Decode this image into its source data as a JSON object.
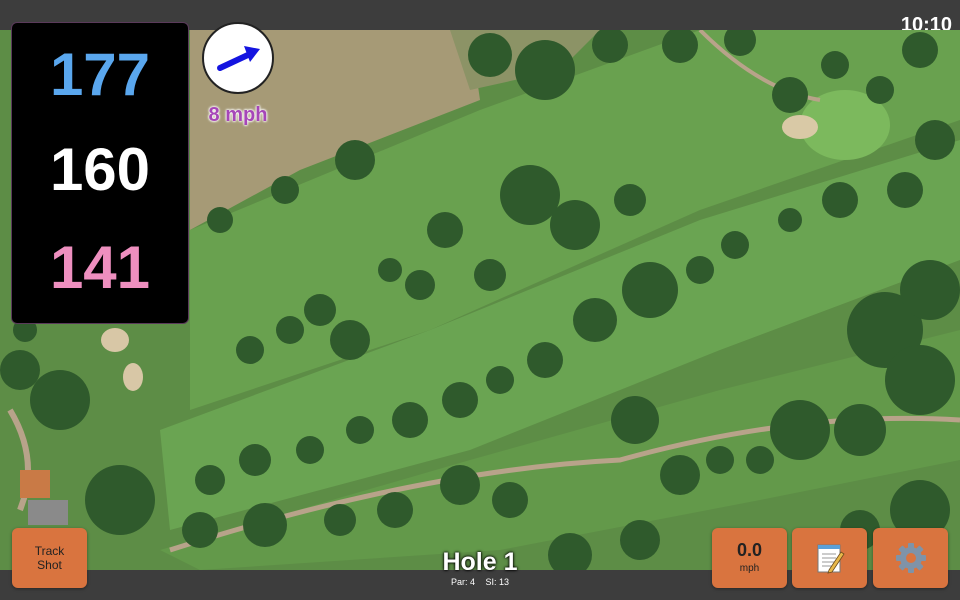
{
  "status_bar": {
    "time": "10:10"
  },
  "distances": {
    "back": "177",
    "middle": "160",
    "front": "141"
  },
  "wind": {
    "speed_label": "8 mph",
    "direction_icon": "wind-arrow-icon"
  },
  "hole": {
    "title": "Hole 1",
    "par": "Par: 4",
    "stroke_index": "SI: 13"
  },
  "buttons": {
    "track_shot_line1": "Track",
    "track_shot_line2": "Shot",
    "wind_value": "0.0",
    "wind_unit": "mph",
    "notes_icon": "notepad-icon",
    "settings_icon": "gear-icon"
  },
  "colors": {
    "back_distance": "#5aa7ee",
    "middle_distance": "#ffffff",
    "front_distance": "#ee8fbf",
    "button": "#d9743f",
    "wind_text": "#a646b8",
    "wind_arrow": "#1414e0"
  }
}
